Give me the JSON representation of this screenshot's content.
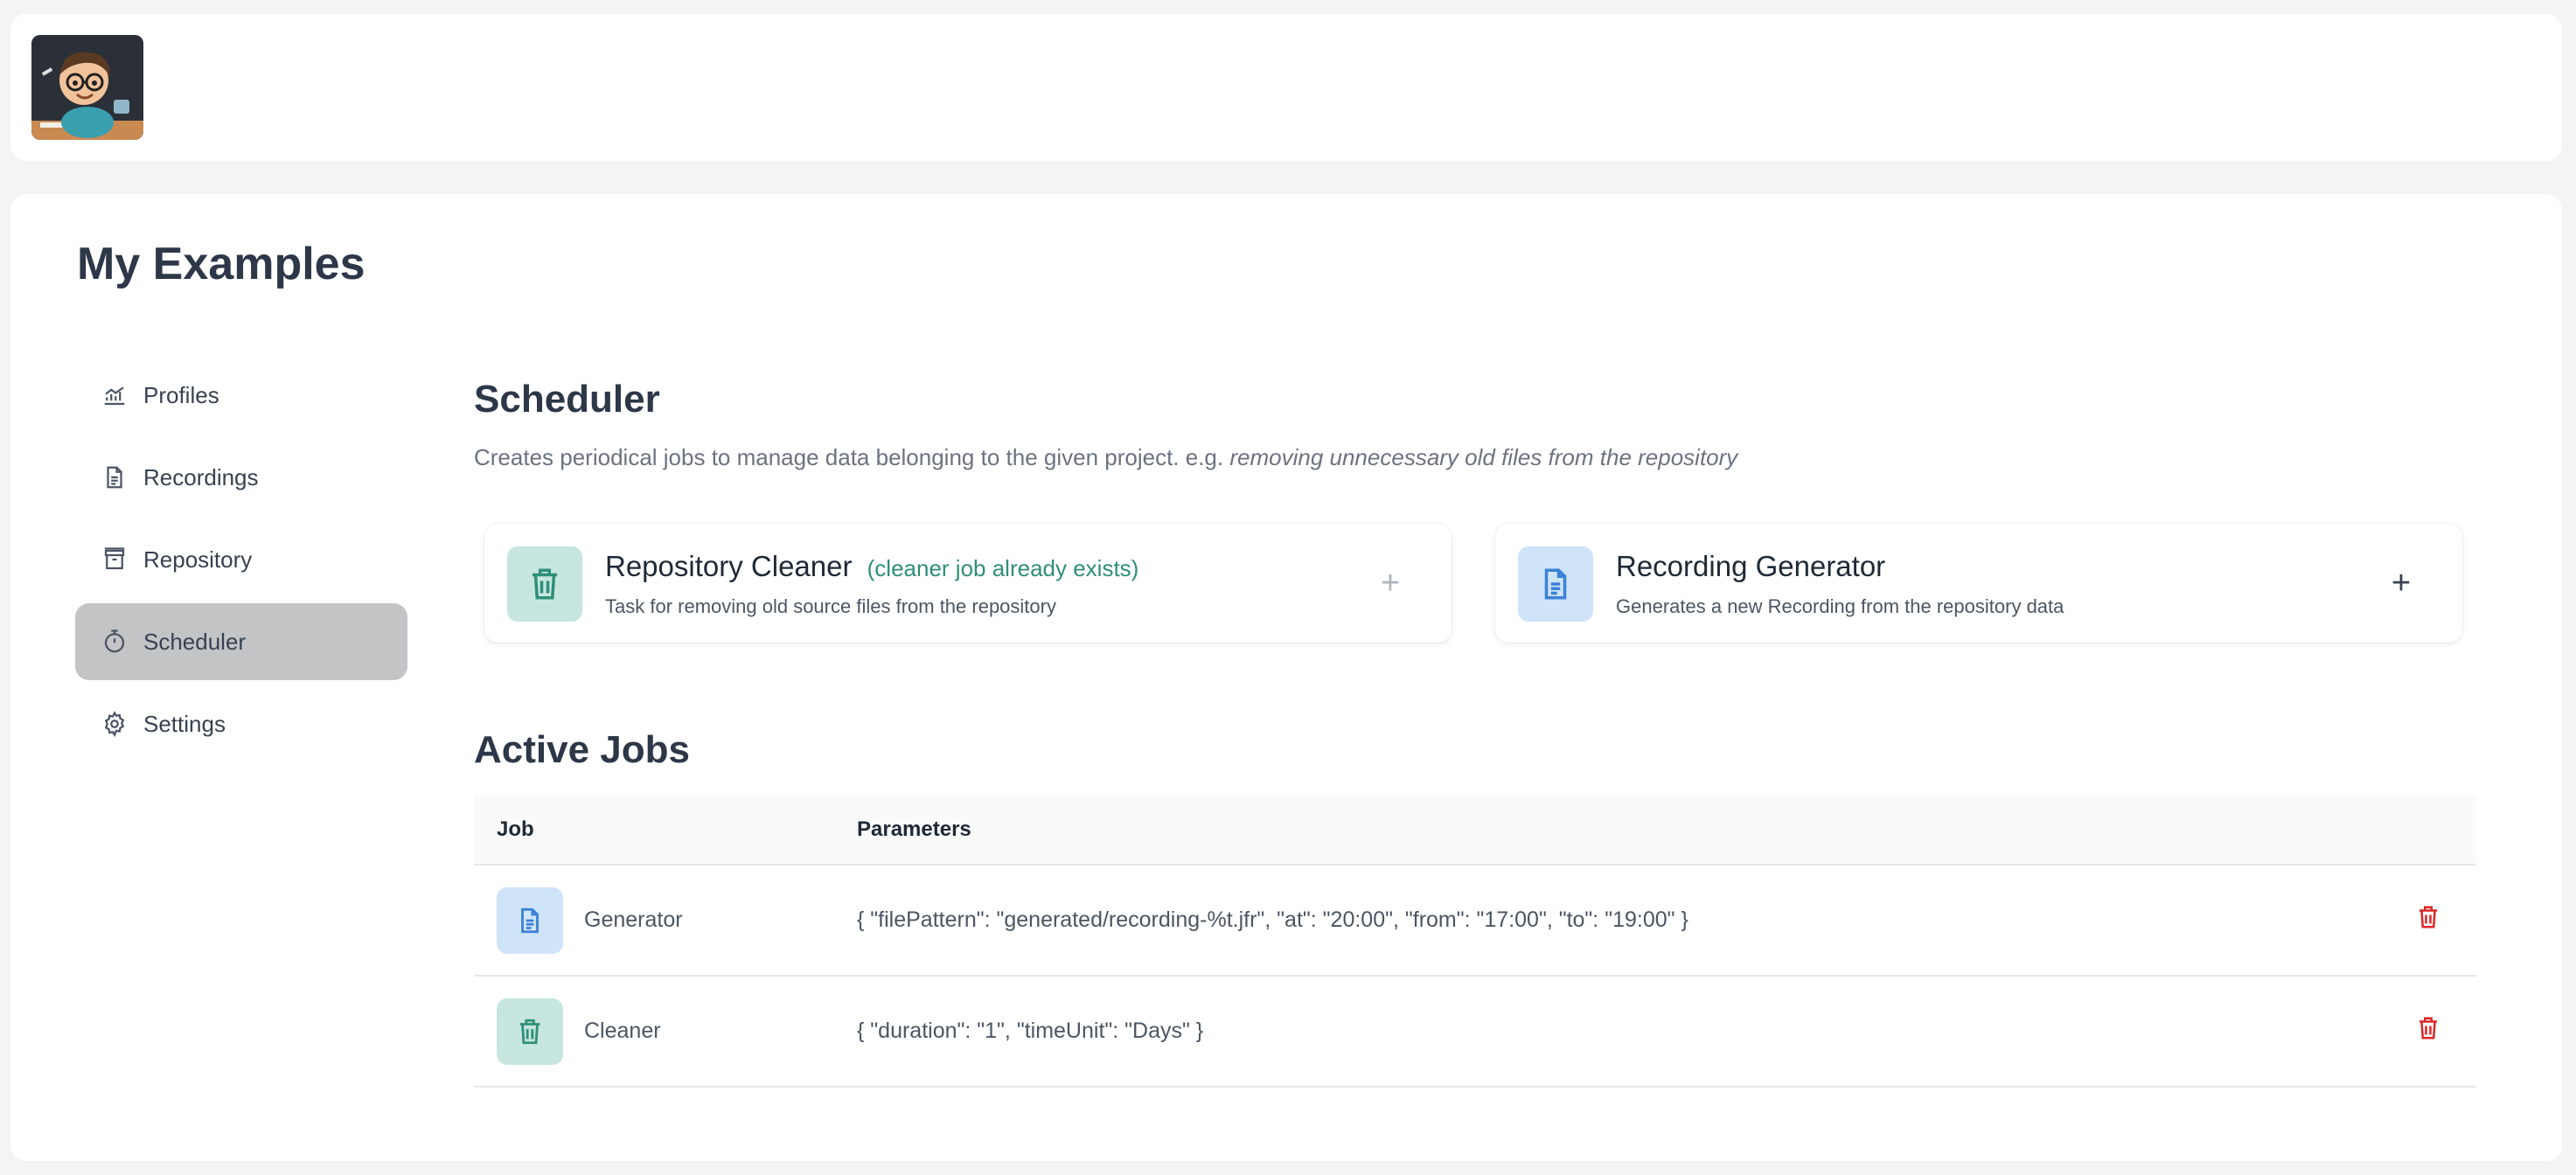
{
  "header": {
    "logo_alt": "cartoon developer avatar"
  },
  "page": {
    "title": "My Examples"
  },
  "sidebar": {
    "items": [
      {
        "label": "Profiles",
        "icon": "chart-line-icon"
      },
      {
        "label": "Recordings",
        "icon": "file-icon"
      },
      {
        "label": "Repository",
        "icon": "archive-icon"
      },
      {
        "label": "Scheduler",
        "icon": "stopwatch-icon",
        "active": true
      },
      {
        "label": "Settings",
        "icon": "gear-icon"
      }
    ]
  },
  "scheduler": {
    "title": "Scheduler",
    "description": "Creates periodical jobs to manage data belonging to the given project. e.g.",
    "description_example": "removing unnecessary old files from the repository",
    "cards": [
      {
        "title": "Repository Cleaner",
        "note": "(cleaner job already exists)",
        "subtitle": "Task for removing old source files from the repository",
        "icon": "trash-icon",
        "add_label": "+",
        "add_enabled": false
      },
      {
        "title": "Recording Generator",
        "note": "",
        "subtitle": "Generates a new Recording from the repository data",
        "icon": "document-icon",
        "add_label": "+",
        "add_enabled": true
      }
    ]
  },
  "active_jobs": {
    "title": "Active Jobs",
    "columns": [
      "Job",
      "Parameters"
    ],
    "rows": [
      {
        "job": "Generator",
        "icon": "document-icon",
        "parameters": "{ \"filePattern\": \"generated/recording-%t.jfr\", \"at\": \"20:00\", \"from\": \"17:00\", \"to\": \"19:00\" }"
      },
      {
        "job": "Cleaner",
        "icon": "trash-icon",
        "parameters": "{ \"duration\": \"1\", \"timeUnit\": \"Days\" }"
      }
    ]
  },
  "colors": {
    "accent_teal": "#2f8f78",
    "accent_blue": "#3b82d6",
    "danger": "#dc2626",
    "active_nav": "#c3c4c6"
  }
}
